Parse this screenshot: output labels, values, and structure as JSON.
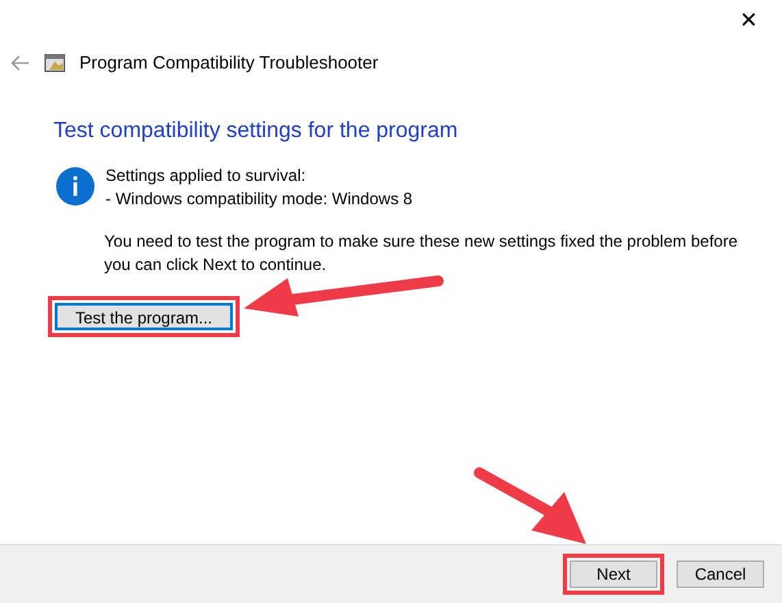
{
  "window": {
    "title": "Program Compatibility Troubleshooter",
    "close": "✕"
  },
  "heading": "Test compatibility settings for the program",
  "info": {
    "lines": [
      "Settings applied to survival:",
      "- Windows compatibility mode: Windows 8"
    ]
  },
  "message": "You need to test the program to make sure these new settings fixed the problem before you can click Next to continue.",
  "test_button": {
    "label": "Test the program...",
    "highlighted": true
  },
  "footer_buttons": [
    {
      "label": "Next",
      "highlighted": true
    },
    {
      "label": "Cancel",
      "highlighted": false
    }
  ]
}
